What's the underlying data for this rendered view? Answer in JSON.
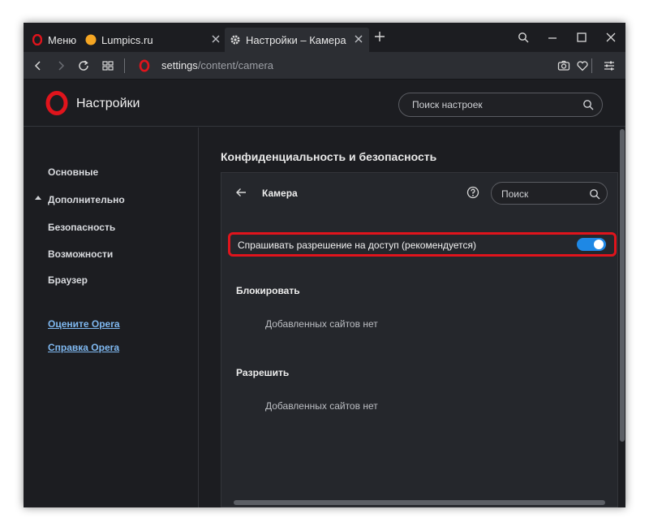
{
  "tabs": {
    "menu_label": "Меню",
    "lumpics_label": "Lumpics.ru",
    "active_label": "Настройки – Камера"
  },
  "address": {
    "url_host": "settings",
    "url_path": "/content/camera"
  },
  "header": {
    "title": "Настройки",
    "search_placeholder": "Поиск настроек"
  },
  "sidebar": {
    "items": [
      {
        "label": "Основные"
      },
      {
        "label": "Дополнительно"
      },
      {
        "label": "Безопасность"
      },
      {
        "label": "Возможности"
      },
      {
        "label": "Браузер"
      }
    ],
    "links": [
      {
        "label": "Оцените Opera"
      },
      {
        "label": "Справка Opera"
      }
    ]
  },
  "main": {
    "section_title": "Конфиденциальность и безопасность",
    "card_title": "Камера",
    "card_search_placeholder": "Поиск",
    "ask_label": "Спрашивать разрешение на доступ (рекомендуется)",
    "ask_enabled": true,
    "block_title": "Блокировать",
    "block_empty": "Добавленных сайтов нет",
    "allow_title": "Разрешить",
    "allow_empty": "Добавленных сайтов нет"
  },
  "colors": {
    "accent": "#1e88e5",
    "highlight": "#e0141c",
    "link": "#7fb8f0",
    "opera_red": "#e0141c"
  }
}
